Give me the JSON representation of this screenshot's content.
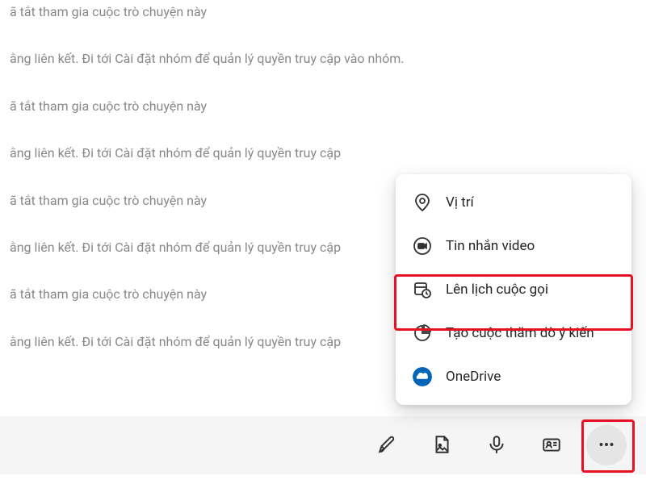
{
  "messages": [
    "ã tắt tham gia cuộc trò chuyện này",
    "ằng liên kết. Đi tới Cài đặt nhóm để quản lý quyền truy cập vào nhóm.",
    "ã tắt tham gia cuộc trò chuyện này",
    "ằng liên kết. Đi tới Cài đặt nhóm để quản lý quyền truy cập",
    "ã tắt tham gia cuộc trò chuyện này",
    "ằng liên kết. Đi tới Cài đặt nhóm để quản lý quyền truy cập",
    "ã tắt tham gia cuộc trò chuyện này",
    "ằng liên kết. Đi tới Cài đặt nhóm để quản lý quyền truy cập"
  ],
  "menu": {
    "items": [
      {
        "key": "location",
        "label": "Vị trí"
      },
      {
        "key": "video-message",
        "label": "Tin nhắn video"
      },
      {
        "key": "schedule-call",
        "label": "Lên lịch cuộc gọi"
      },
      {
        "key": "create-poll",
        "label": "Tạo cuộc thăm dò ý kiến"
      },
      {
        "key": "onedrive",
        "label": "OneDrive"
      }
    ]
  },
  "composer": {
    "format_label": "Format",
    "attach_label": "Attach file",
    "voice_label": "Voice message",
    "card_label": "Contact card",
    "more_label": "More options"
  }
}
